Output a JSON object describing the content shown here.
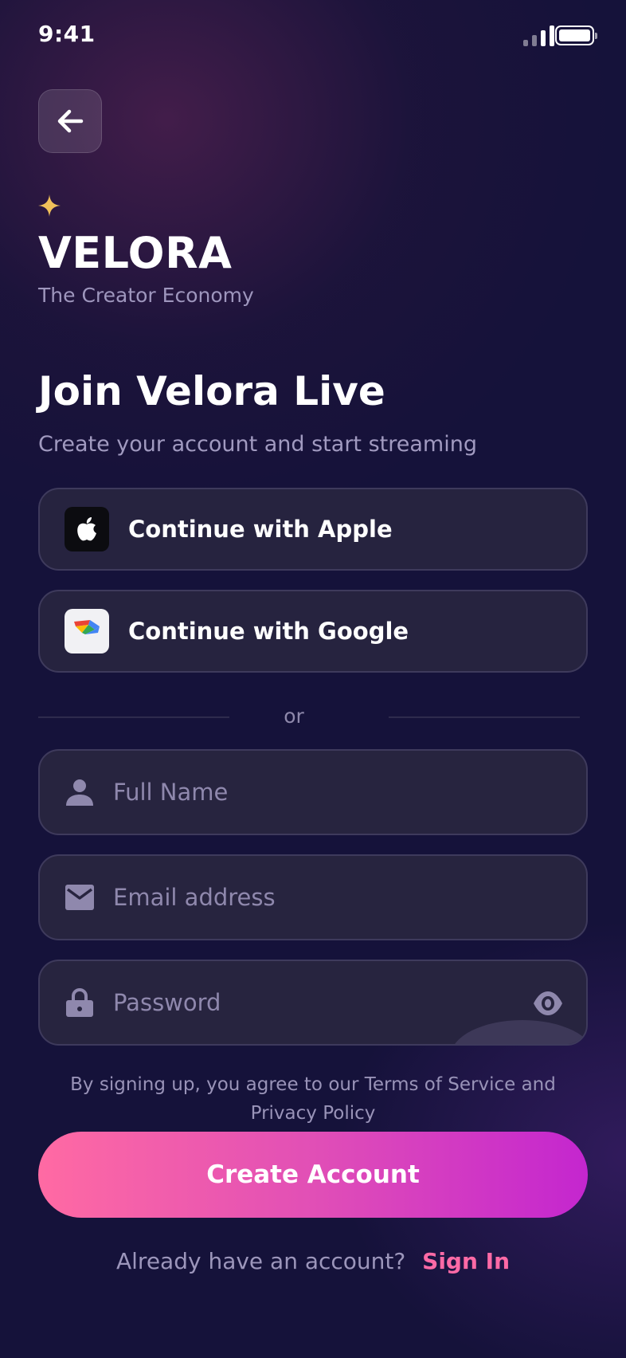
{
  "status_bar": {
    "time": "9:41"
  },
  "brand": {
    "name": "VELORA",
    "tagline": "The Creator Economy"
  },
  "header": {
    "title": "Join Velora Live",
    "subtitle": "Create your account and start streaming"
  },
  "social": {
    "apple_label": "Continue with Apple",
    "google_label": "Continue with Google"
  },
  "divider": {
    "text": "or"
  },
  "form": {
    "name_placeholder": "Full Name",
    "email_placeholder": "Email address",
    "password_placeholder": "Password",
    "name_value": "",
    "email_value": "",
    "password_value": ""
  },
  "terms": {
    "text": "By signing up, you agree to our Terms of Service and Privacy Policy"
  },
  "cta": {
    "create_label": "Create Account"
  },
  "footer": {
    "question": "Already have an account?",
    "signin_label": "Sign In"
  },
  "colors": {
    "background": "#15123a",
    "accent_pink": "#ff6aa6",
    "accent_purple": "#c426cf",
    "sparkle": "#f0c05a"
  },
  "icons": {
    "back": "arrow-left-icon",
    "sparkle": "sparkle-icon",
    "apple": "apple-logo-icon",
    "google": "google-logo-icon",
    "name": "user-icon",
    "email": "mail-icon",
    "password": "lock-icon",
    "toggle": "eye-icon"
  }
}
